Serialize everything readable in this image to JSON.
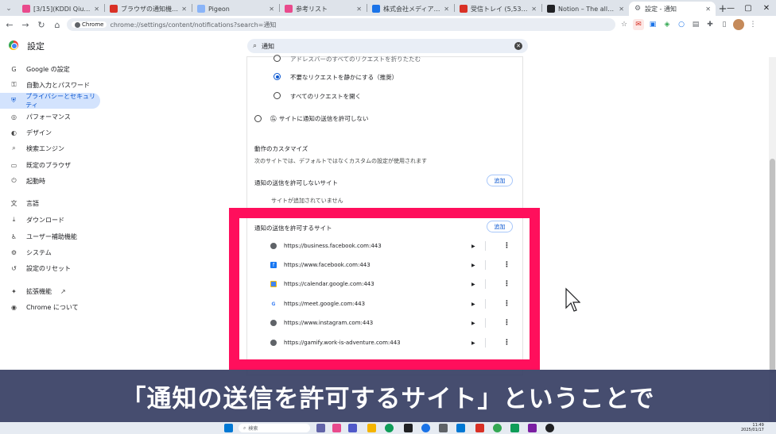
{
  "tabs": [
    {
      "label": "[3/15](KDDI Qiutwork · ...",
      "color": "#e94a8c"
    },
    {
      "label": "ブラウザの通知機能から不申...",
      "color": "#d93025"
    },
    {
      "label": "Pigeon",
      "color": "#8ab4f8"
    },
    {
      "label": "参考リスト",
      "color": "#e94a8c"
    },
    {
      "label": "株式会社メディアラボ アル...",
      "color": "#1a73e8"
    },
    {
      "label": "受信トレイ (5,535) - kobay...",
      "color": "#d93025"
    },
    {
      "label": "Notion – The all-in-one wo...",
      "color": "#202124"
    },
    {
      "label": "設定 - 通知",
      "color": "#5f6368",
      "active": true
    }
  ],
  "toolbar": {
    "chip_label": "Chrome",
    "url": "chrome://settings/content/notifications?search=通知"
  },
  "settings": {
    "title": "設定",
    "search_value": "通知"
  },
  "sidebar": {
    "items": [
      {
        "label": "Google の設定",
        "icon": "G"
      },
      {
        "label": "自動入力とパスワード",
        "icon": "⚿"
      },
      {
        "label": "プライバシーとセキュリティ",
        "icon": "⛨",
        "active": true
      },
      {
        "label": "パフォーマンス",
        "icon": "◎"
      },
      {
        "label": "デザイン",
        "icon": "◐"
      },
      {
        "label": "検索エンジン",
        "icon": "⌕"
      },
      {
        "label": "既定のブラウザ",
        "icon": "▭"
      },
      {
        "label": "起動時",
        "icon": "⏻"
      },
      {
        "label": "言語",
        "icon": "文"
      },
      {
        "label": "ダウンロード",
        "icon": "⤓"
      },
      {
        "label": "ユーザー補助機能",
        "icon": "♿"
      },
      {
        "label": "システム",
        "icon": "⚙"
      },
      {
        "label": "設定のリセット",
        "icon": "↺"
      },
      {
        "label": "拡張機能",
        "icon": "✦"
      },
      {
        "label": "Chrome について",
        "icon": "◉"
      }
    ]
  },
  "content": {
    "radio_partial": "アドレスバーのすべてのリクエストを折りたたむ",
    "radio_quiet": "不要なリクエストを静かにする（推奨）",
    "radio_expand": "すべてのリクエストを開く",
    "radio_block": "サイトに通知の送信を許可しない",
    "custom_title": "動作のカスタマイズ",
    "custom_desc": "次のサイトでは、デフォルトではなくカスタムの設定が使用されます",
    "blocked_title": "通知の送信を許可しないサイト",
    "blocked_empty": "サイトが追加されていません",
    "add_label": "追加",
    "allowed_title": "通知の送信を許可するサイト",
    "allowed_sites": [
      {
        "url": "https://business.facebook.com:443",
        "icon": "globe"
      },
      {
        "url": "https://www.facebook.com:443",
        "icon": "facebook"
      },
      {
        "url": "https://calendar.google.com:443",
        "icon": "calendar"
      },
      {
        "url": "https://meet.google.com:443",
        "icon": "google"
      },
      {
        "url": "https://www.instagram.com:443",
        "icon": "globe"
      },
      {
        "url": "https://gamify.work-is-adventure.com:443",
        "icon": "globe"
      }
    ]
  },
  "caption": "「通知の送信を許可するサイト」ということで",
  "taskbar": {
    "search_placeholder": "検索",
    "time": "11:49",
    "date": "2025/01/17"
  }
}
